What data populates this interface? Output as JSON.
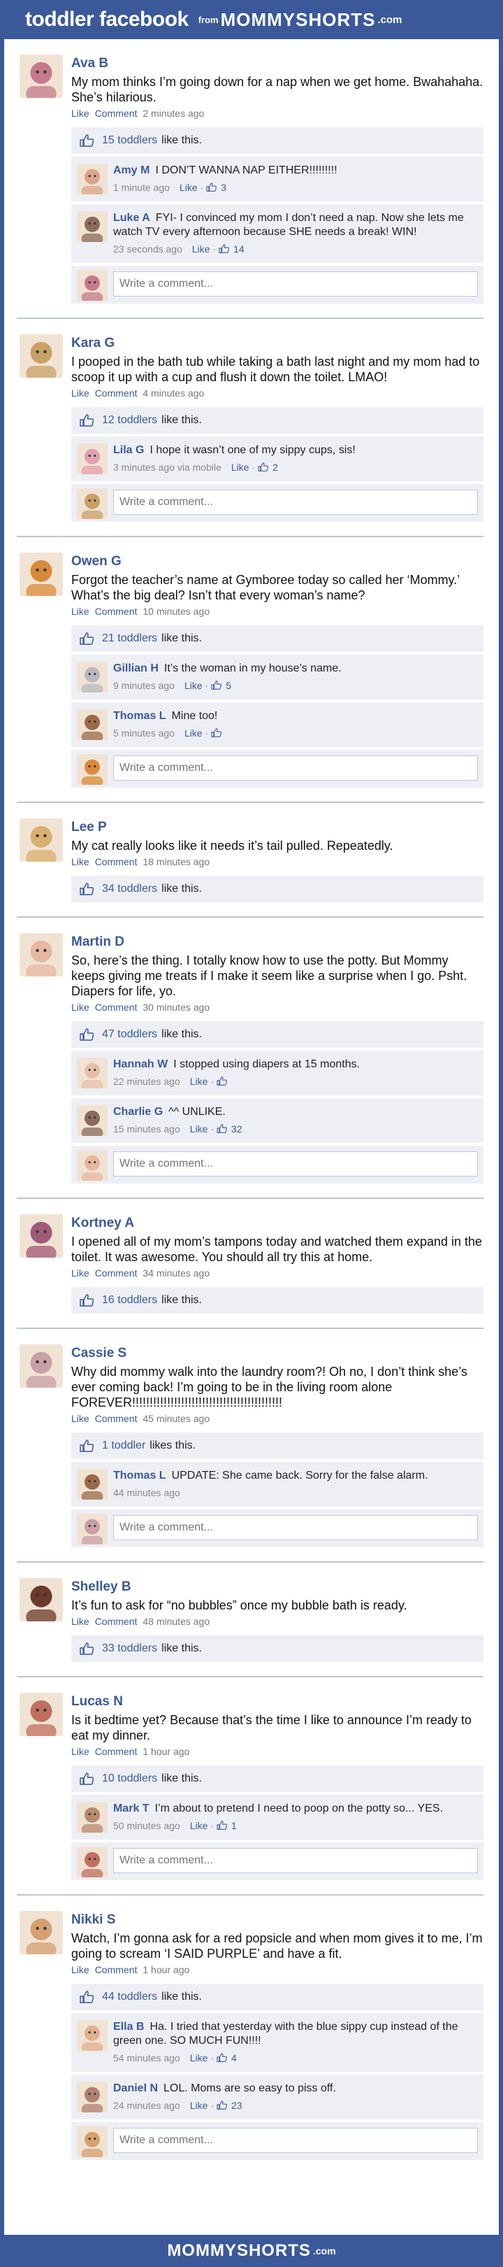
{
  "header": {
    "title": "toddler facebook",
    "from": "from",
    "brand": "MOMMYSHORTS",
    "com": ".com"
  },
  "footer": {
    "brand": "MOMMYSHORTS",
    "com": ".com"
  },
  "ui": {
    "like": "Like",
    "comment": "Comment",
    "write_placeholder": "Write a comment...",
    "dash": "·"
  },
  "colors": {
    "facebook_blue": "#3b5998",
    "feedback_bg": "#edeff4",
    "divider": "#bfc5ce"
  },
  "posts": [
    {
      "name": "Ava B",
      "avatar_color": "#c47a8a",
      "text": "My mom thinks I’m going down for a nap when we get home. Bwahahaha. She’s hilarious.",
      "time": "2 minutes ago",
      "likes": "15 toddlers",
      "likes_suffix": "like this.",
      "comments": [
        {
          "name": "Amy M",
          "text": "I DON’T WANNA NAP EITHER!!!!!!!!!",
          "time": "1 minute ago",
          "likes": "3",
          "avatar_color": "#d9a58a"
        },
        {
          "name": "Luke A",
          "text": "FYI- I convinced my mom I don’t need a nap. Now she lets me watch TV every afternoon because SHE needs a break! WIN!",
          "time": "23 seconds ago",
          "likes": "14",
          "avatar_color": "#8a6a5a"
        }
      ],
      "write": true
    },
    {
      "name": "Kara G",
      "avatar_color": "#c9a067",
      "text": "I pooped in the bath tub while taking a bath last night and my mom had to scoop it up with a cup and flush it down the toilet. LMAO!",
      "time": "4 minutes ago",
      "likes": "12 toddlers",
      "likes_suffix": "like this.",
      "comments": [
        {
          "name": "Lila G",
          "text": "I hope it wasn’t one of my sippy cups, sis!",
          "time": "3 minutes ago via mobile",
          "likes": "2",
          "avatar_color": "#e2a0b0"
        }
      ],
      "write": true
    },
    {
      "name": "Owen G",
      "avatar_color": "#d88a3a",
      "text": "Forgot the teacher’s name at Gymboree today so called her ‘Mommy.’ What’s the big deal? Isn’t that every woman’s name?",
      "time": "10 minutes ago",
      "likes": "21 toddlers",
      "likes_suffix": "like this.",
      "comments": [
        {
          "name": "Gillian H",
          "text": "It’s the woman in my house’s name.",
          "time": "9 minutes ago",
          "likes": "5",
          "avatar_color": "#b8b8c0"
        },
        {
          "name": "Thomas L",
          "text": "Mine too!",
          "time": "5 minutes ago",
          "likes": "",
          "avatar_color": "#9a6b4a"
        }
      ],
      "write": true
    },
    {
      "name": "Lee P",
      "avatar_color": "#d8b070",
      "text": "My cat really looks like it needs it’s tail pulled. Repeatedly.",
      "time": "18 minutes ago",
      "likes": "34 toddlers",
      "likes_suffix": "like this.",
      "comments": [],
      "write": false
    },
    {
      "name": "Martin D",
      "avatar_color": "#e6b8a0",
      "text": "So, here’s the thing. I totally know how to use the potty. But Mommy keeps giving me treats if I make it seem like a surprise when I go. Psht. Diapers for life, yo.",
      "time": "30 minutes ago",
      "likes": "47 toddlers",
      "likes_suffix": "like this.",
      "comments": [
        {
          "name": "Hannah W",
          "text": "I stopped using diapers at 15 months.",
          "time": "22 minutes ago",
          "likes": "",
          "avatar_color": "#e8c0a8"
        },
        {
          "name": "Charlie G",
          "text": "^^ UNLIKE.",
          "time": "15 minutes ago",
          "likes": "32",
          "avatar_color": "#8a6a5a"
        }
      ],
      "write": true
    },
    {
      "name": "Kortney A",
      "avatar_color": "#a05a7a",
      "text": "I opened all of my mom’s tampons today and watched them expand in the toilet. It was awesome. You should all try this at home.",
      "time": "34 minutes ago",
      "likes": "16 toddlers",
      "likes_suffix": "like this.",
      "comments": [],
      "write": false
    },
    {
      "name": "Cassie S",
      "avatar_color": "#c8a0a8",
      "text": "Why did mommy walk into the laundry room?! Oh no, I don’t think she’s ever coming back! I’m going to be in the living room alone FOREVER!!!!!!!!!!!!!!!!!!!!!!!!!!!!!!!!!!!!!!!!!!!",
      "time": "45 minutes ago",
      "likes": "1 toddler",
      "likes_suffix": "likes this.",
      "comments": [
        {
          "name": "Thomas L",
          "text": "UPDATE: She came back. Sorry for the false alarm.",
          "time": "44 minutes ago",
          "likes": null,
          "avatar_color": "#9a6b4a"
        }
      ],
      "write": true
    },
    {
      "name": "Shelley B",
      "avatar_color": "#6a3a2a",
      "text": "It’s fun to ask for “no bubbles” once my bubble bath is ready.",
      "time": "48 minutes ago",
      "likes": "33 toddlers",
      "likes_suffix": "like this.",
      "comments": [],
      "write": false
    },
    {
      "name": "Lucas N",
      "avatar_color": "#c07060",
      "text": "Is it bedtime yet? Because that’s the time I like to announce I’m ready to eat my dinner.",
      "time": "1 hour ago",
      "likes": "10 toddlers",
      "likes_suffix": "like this.",
      "comments": [
        {
          "name": "Mark T",
          "text": "I’m about to pretend I need to poop on the potty so... YES.",
          "time": "50 minutes ago",
          "likes": "1",
          "avatar_color": "#b88a70"
        }
      ],
      "write": true
    },
    {
      "name": "Nikki S",
      "avatar_color": "#d4a070",
      "text": "Watch, I’m gonna ask for a red popsicle and when mom gives it to me, I’m going to scream ‘I SAID PURPLE’ and have a fit.",
      "time": "1 hour ago",
      "likes": "44 toddlers",
      "likes_suffix": "like this.",
      "comments": [
        {
          "name": "Ella B",
          "text": "Ha. I tried that yesterday with the blue sippy cup instead of the green one. SO MUCH FUN!!!!",
          "time": "54 minutes ago",
          "likes": "4",
          "avatar_color": "#e0b090"
        },
        {
          "name": "Daniel N",
          "text": "LOL. Moms are so easy to piss off.",
          "time": "24 minutes ago",
          "likes": "23",
          "avatar_color": "#b08070"
        }
      ],
      "write": true
    }
  ]
}
